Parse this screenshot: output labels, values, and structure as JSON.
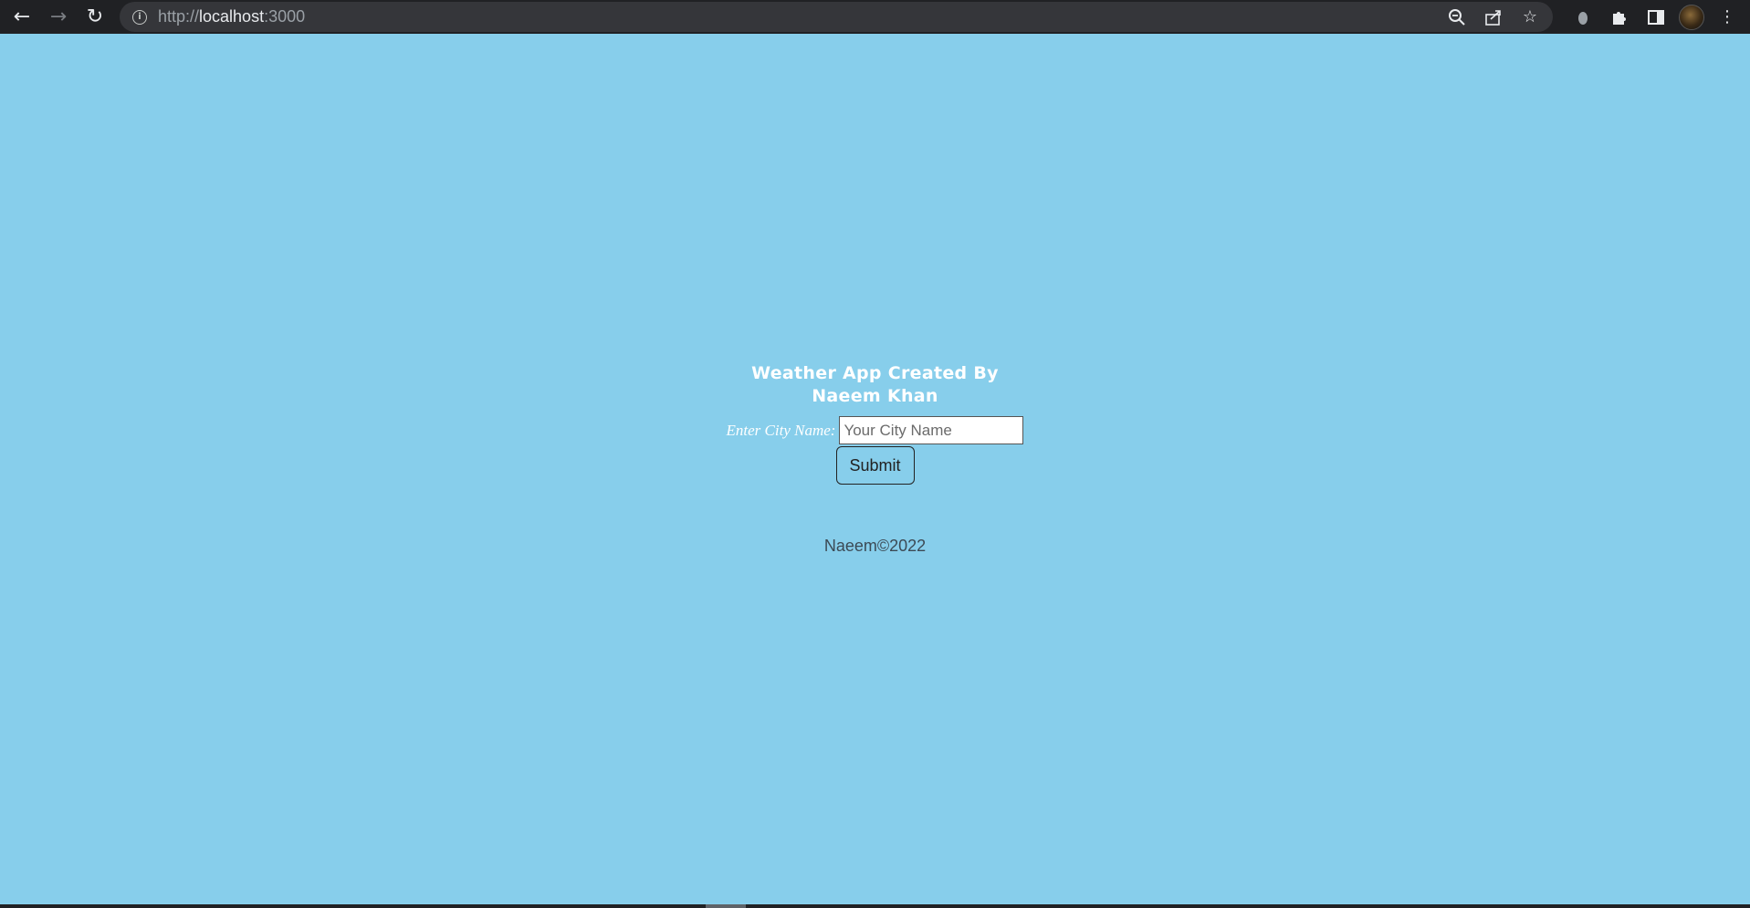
{
  "browser": {
    "url_prefix": "http://",
    "url_host": "localhost",
    "url_port": ":3000",
    "icons": [
      "back-icon",
      "forward-icon",
      "reload-icon",
      "info-icon",
      "zoom-icon",
      "share-icon",
      "star-icon",
      "extension-icon",
      "puzzle-icon",
      "side-panel-icon",
      "profile-avatar",
      "menu-icon"
    ]
  },
  "page": {
    "background_color": "#87ceeb",
    "title_line1": "Weather App Created By",
    "title_line2": "Naeem Khan",
    "city_label": "Enter City Name:",
    "city_placeholder": "Your City Name",
    "submit_label": "Submit",
    "footer": "Naeem©2022"
  }
}
